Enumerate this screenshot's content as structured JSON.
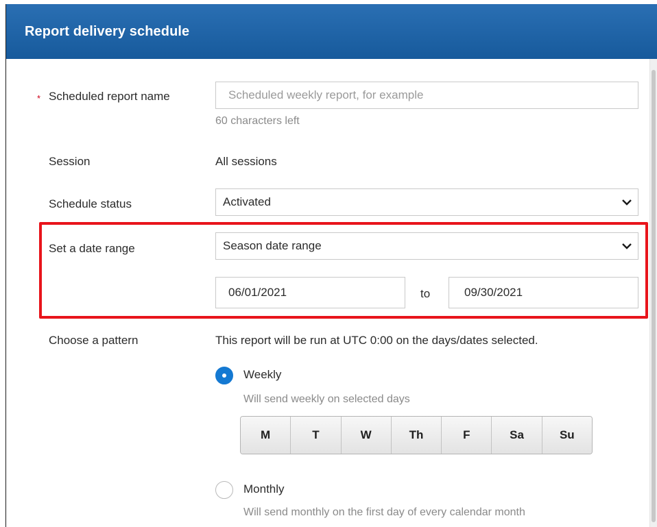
{
  "dialog": {
    "title": "Report delivery schedule"
  },
  "form": {
    "name": {
      "required_mark": "*",
      "label": "Scheduled report name",
      "placeholder": "Scheduled weekly report, for example",
      "helper": "60 characters left"
    },
    "session": {
      "label": "Session",
      "value": "All sessions"
    },
    "status": {
      "label": "Schedule status",
      "selected": "Activated"
    },
    "date_range": {
      "label": "Set a date range",
      "selected": "Season date range",
      "start": "06/01/2021",
      "to_label": "to",
      "end": "09/30/2021"
    },
    "pattern": {
      "label": "Choose a pattern",
      "description": "This report will be run at UTC 0:00 on the days/dates selected.",
      "weekly": {
        "label": "Weekly",
        "helper": "Will send weekly on selected days",
        "selected": true
      },
      "days": [
        "M",
        "T",
        "W",
        "Th",
        "F",
        "Sa",
        "Su"
      ],
      "monthly": {
        "label": "Monthly",
        "helper": "Will send monthly on the first day of every calendar month",
        "selected": false
      }
    }
  },
  "colors": {
    "header": "#1f66aa",
    "highlight": "#e8141b",
    "radio_selected": "#1479d2",
    "required": "#d0021b"
  }
}
